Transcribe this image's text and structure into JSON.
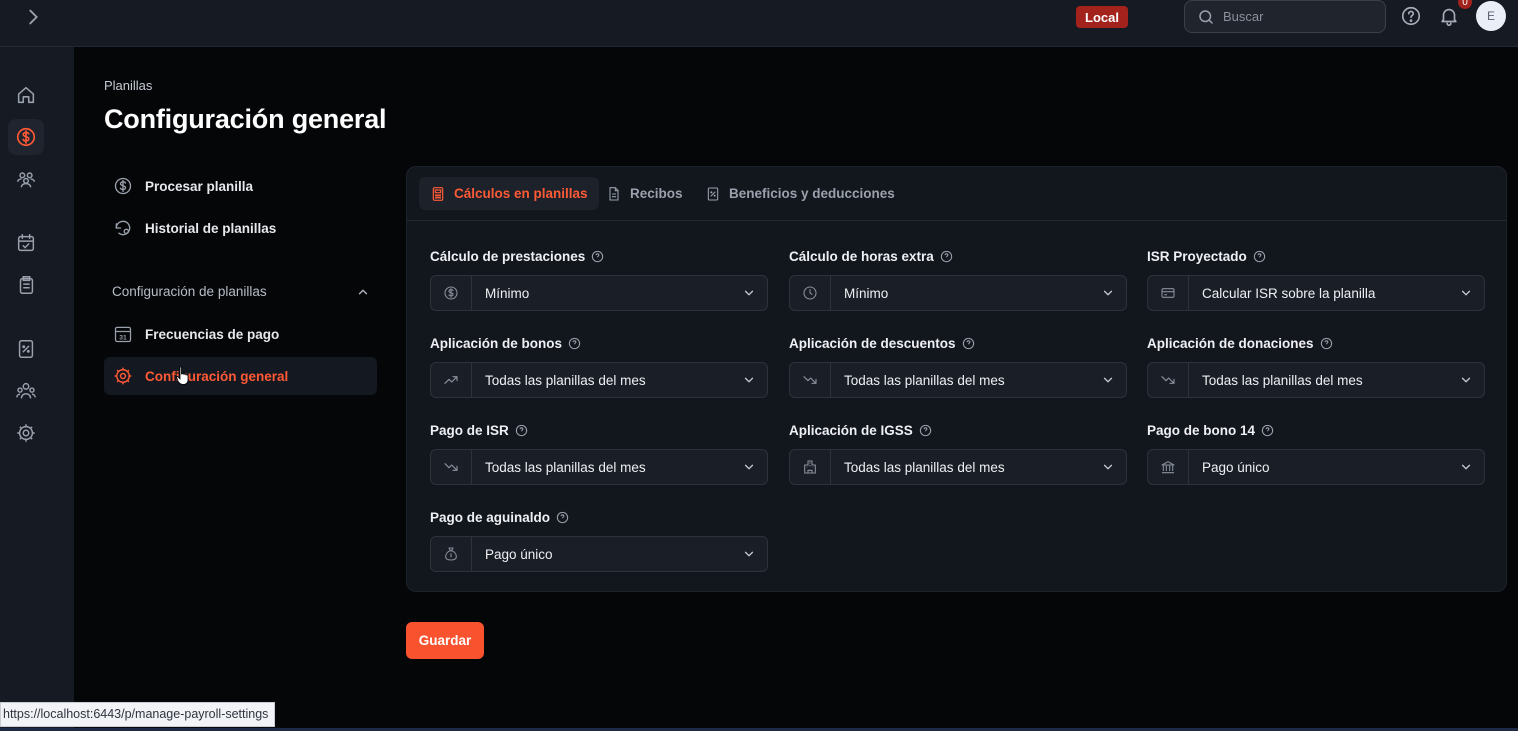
{
  "topbar": {
    "env_badge": "Local",
    "search_placeholder": "Buscar",
    "notification_count": "0",
    "avatar_initial": "E"
  },
  "rail": {
    "items": [
      "home",
      "payroll",
      "employees",
      "attendance",
      "documents",
      "taxes",
      "teams",
      "settings"
    ]
  },
  "breadcrumb": "Planillas",
  "page_title": "Configuración general",
  "subnav": {
    "process": "Procesar planilla",
    "history": "Historial de planillas",
    "section": "Configuración de planillas",
    "frequencies": "Frecuencias de pago",
    "general": "Configuración general",
    "calendar_day": "31"
  },
  "tabs": {
    "calculations": "Cálculos en planillas",
    "receipts": "Recibos",
    "benefits": "Beneficios y deducciones"
  },
  "fields": {
    "prestaciones": {
      "label": "Cálculo de prestaciones",
      "value": "Mínimo"
    },
    "horas_extra": {
      "label": "Cálculo de horas extra",
      "value": "Mínimo"
    },
    "isr_proyectado": {
      "label": "ISR Proyectado",
      "value": "Calcular ISR sobre la planilla"
    },
    "bonos": {
      "label": "Aplicación de bonos",
      "value": "Todas las planillas del mes"
    },
    "descuentos": {
      "label": "Aplicación de descuentos",
      "value": "Todas las planillas del mes"
    },
    "donaciones": {
      "label": "Aplicación de donaciones",
      "value": "Todas las planillas del mes"
    },
    "pago_isr": {
      "label": "Pago de ISR",
      "value": "Todas las planillas del mes"
    },
    "igss": {
      "label": "Aplicación de IGSS",
      "value": "Todas las planillas del mes"
    },
    "bono14": {
      "label": "Pago de bono 14",
      "value": "Pago único"
    },
    "aguinaldo": {
      "label": "Pago de aguinaldo",
      "value": "Pago único"
    }
  },
  "save_label": "Guardar",
  "status_url": "https://localhost:6443/p/manage-payroll-settings",
  "colors": {
    "accent": "#f9522e",
    "badge": "#a3221c",
    "background": "#050608"
  }
}
